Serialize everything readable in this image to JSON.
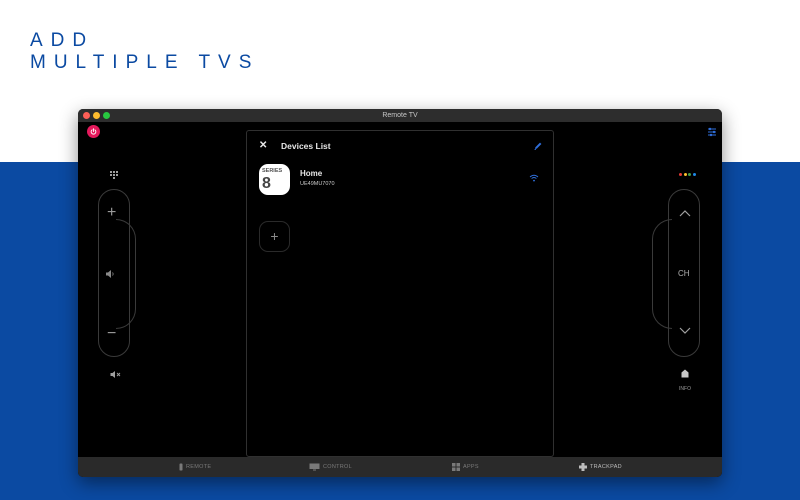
{
  "headline": {
    "line1": "ADD",
    "line2": "MULTIPLE TVS"
  },
  "window": {
    "title": "Remote TV"
  },
  "remote_left": {
    "keypad_icon": "keypad-grid-icon",
    "volume_plus": "+",
    "volume_minus": "−",
    "speaker_icon": "speaker-icon",
    "mute_icon": "mute-icon"
  },
  "remote_right": {
    "channel_label": "CH",
    "info_label": "INFO",
    "dots_colors": [
      "#e53935",
      "#fbc02d",
      "#43a047",
      "#1e88e5"
    ]
  },
  "devices_panel": {
    "close_label": "✕",
    "title": "Devices List",
    "edit_icon": "pencil-icon",
    "devices": [
      {
        "logo_word": "SERIES",
        "logo_number": "8",
        "name": "Home",
        "model": "UE49MU7070",
        "status_icon": "wifi-icon"
      }
    ],
    "add_label": "+"
  },
  "tabbar": {
    "tabs": [
      {
        "label": "REMOTE",
        "icon": "remote-icon"
      },
      {
        "label": "CONTROL",
        "icon": "monitor-icon"
      },
      {
        "label": "APPS",
        "icon": "apps-grid-icon"
      },
      {
        "label": "TRACKPAD",
        "icon": "trackpad-icon",
        "active": true
      }
    ]
  },
  "colors": {
    "brand_blue": "#0b4aa2",
    "power_red": "#e5195c",
    "accent_blue": "#2f6fdc"
  }
}
